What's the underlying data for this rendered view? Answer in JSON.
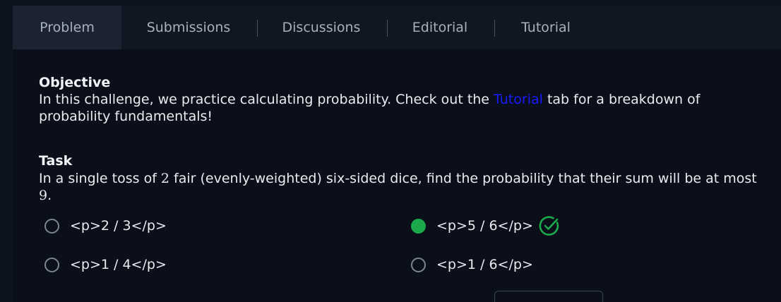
{
  "tabs": {
    "problem": "Problem",
    "submissions": "Submissions",
    "discussions": "Discussions",
    "editorial": "Editorial",
    "tutorial": "Tutorial"
  },
  "objective": {
    "title": "Objective",
    "text_before_link": "In this challenge, we practice calculating probability. Check out the ",
    "link": "Tutorial",
    "text_after_link": " tab for a breakdown of probability fundamentals!"
  },
  "task": {
    "title": "Task",
    "text_1": "In a single toss of ",
    "num_dice": "2",
    "text_2": " fair (evenly-weighted) six-sided dice, find the probability that their sum will be at most ",
    "max_sum": "9",
    "text_3": "."
  },
  "options": [
    {
      "label": "<p>2 / 3</p>",
      "selected": false
    },
    {
      "label": "<p>5 / 6</p>",
      "selected": true,
      "correct": true
    },
    {
      "label": "<p>1 / 4</p>",
      "selected": false
    },
    {
      "label": "<p>1 / 6</p>",
      "selected": false
    }
  ],
  "colors": {
    "background": "#0a0f1a",
    "accent_green": "#1ba94c",
    "link_blue": "#1a1aff"
  },
  "icons": {
    "correct": "check-circle-icon"
  }
}
